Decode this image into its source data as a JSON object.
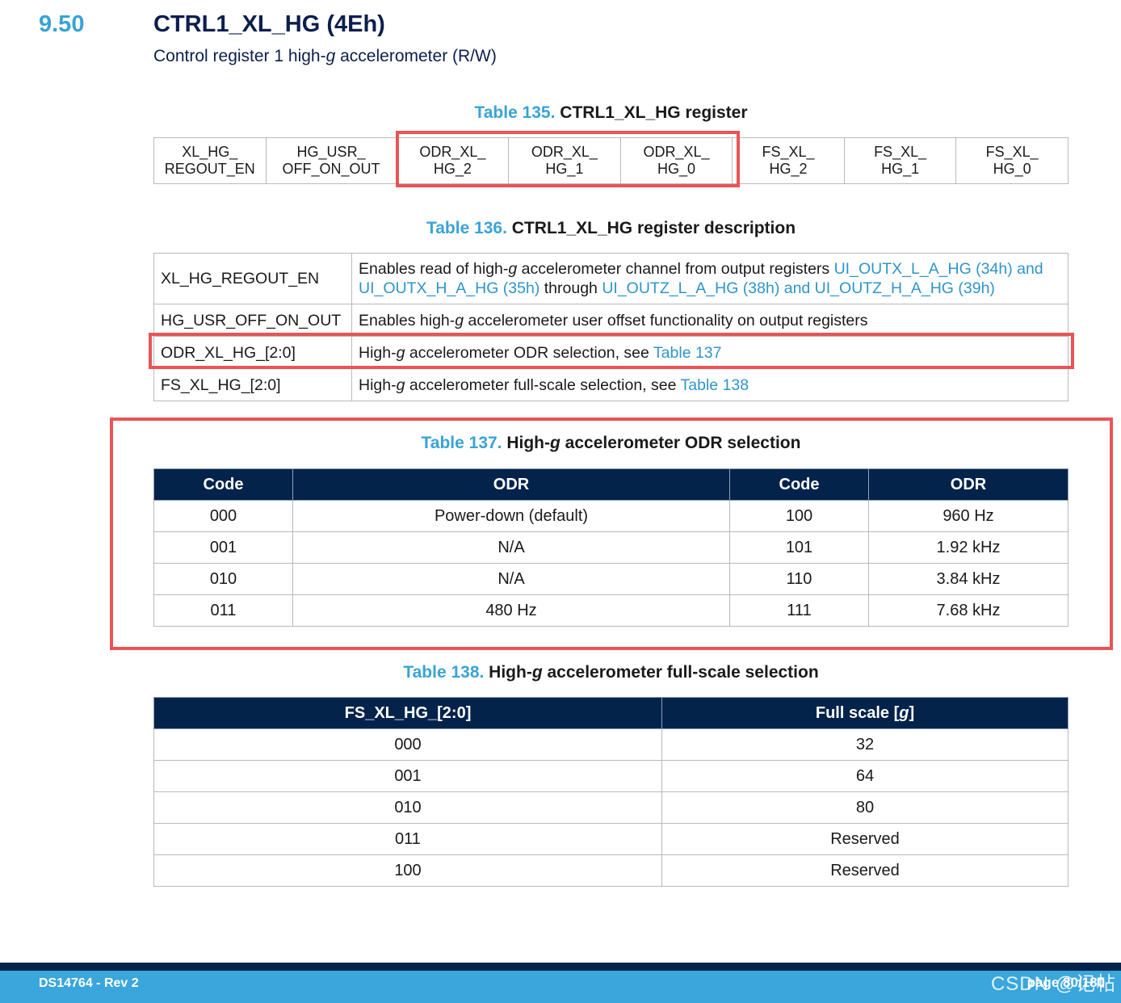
{
  "section": {
    "number": "9.50",
    "title": "CTRL1_XL_HG (4Eh)",
    "subtitle_pre": "Control register 1 high-",
    "subtitle_g": "g",
    "subtitle_post": " accelerometer (R/W)"
  },
  "table135": {
    "caption_num": "Table 135.",
    "caption_text": " CTRL1_XL_HG register",
    "bits": [
      {
        "line1": "XL_HG_",
        "line2": "REGOUT_EN"
      },
      {
        "line1": "HG_USR_",
        "line2": "OFF_ON_OUT"
      },
      {
        "line1": "ODR_XL_",
        "line2": "HG_2"
      },
      {
        "line1": "ODR_XL_",
        "line2": "HG_1"
      },
      {
        "line1": "ODR_XL_",
        "line2": "HG_0"
      },
      {
        "line1": "FS_XL_",
        "line2": "HG_2"
      },
      {
        "line1": "FS_XL_",
        "line2": "HG_1"
      },
      {
        "line1": "FS_XL_",
        "line2": "HG_0"
      }
    ]
  },
  "table136": {
    "caption_num": "Table 136.",
    "caption_text": " CTRL1_XL_HG register description",
    "rows": [
      {
        "name": "XL_HG_REGOUT_EN",
        "d1": "Enables read of high-",
        "g": "g",
        "d2": " accelerometer channel from output registers ",
        "l1": "UI_OUTX_L_A_HG (34h) and UI_OUTX_H_A_HG (35h)",
        "d3": " through ",
        "l2": "UI_OUTZ_L_A_HG (38h) and UI_OUTZ_H_A_HG (39h)"
      },
      {
        "name": "HG_USR_OFF_ON_OUT",
        "d1": "Enables high-",
        "g": "g",
        "d2": " accelerometer user offset functionality on output registers"
      },
      {
        "name": "ODR_XL_HG_[2:0]",
        "d1": "High-",
        "g": "g",
        "d2": " accelerometer ODR selection, see ",
        "l1": "Table 137"
      },
      {
        "name": "FS_XL_HG_[2:0]",
        "d1": "High-",
        "g": "g",
        "d2": " accelerometer full-scale selection, see ",
        "l1": "Table 138"
      }
    ]
  },
  "table137": {
    "caption_num": "Table 137.",
    "caption_pre": " High-",
    "caption_g": "g",
    "caption_post": " accelerometer ODR selection",
    "headers": [
      "Code",
      "ODR",
      "Code",
      "ODR"
    ],
    "rows": [
      [
        "000",
        "Power-down (default)",
        "100",
        "960 Hz"
      ],
      [
        "001",
        "N/A",
        "101",
        "1.92 kHz"
      ],
      [
        "010",
        "N/A",
        "110",
        "3.84 kHz"
      ],
      [
        "011",
        "480 Hz",
        "111",
        "7.68 kHz"
      ]
    ]
  },
  "table138": {
    "caption_num": "Table 138.",
    "caption_pre": " High-",
    "caption_g": "g",
    "caption_post": " accelerometer full-scale selection",
    "header1": "FS_XL_HG_[2:0]",
    "header2_pre": "Full scale [",
    "header2_g": "g",
    "header2_post": "]",
    "rows": [
      [
        "000",
        "32"
      ],
      [
        "001",
        "64"
      ],
      [
        "010",
        "80"
      ],
      [
        "011",
        "Reserved"
      ],
      [
        "100",
        "Reserved"
      ]
    ]
  },
  "footer": {
    "doc": "DS14764",
    "sep": " - ",
    "rev": "Rev 2",
    "page": "page 80/180",
    "watermark": "CSDN @记帖"
  },
  "colors": {
    "accent": "#3aa3d5",
    "header_bg": "#03234b",
    "highlight": "#ea5455",
    "link": "#2f95c9"
  }
}
